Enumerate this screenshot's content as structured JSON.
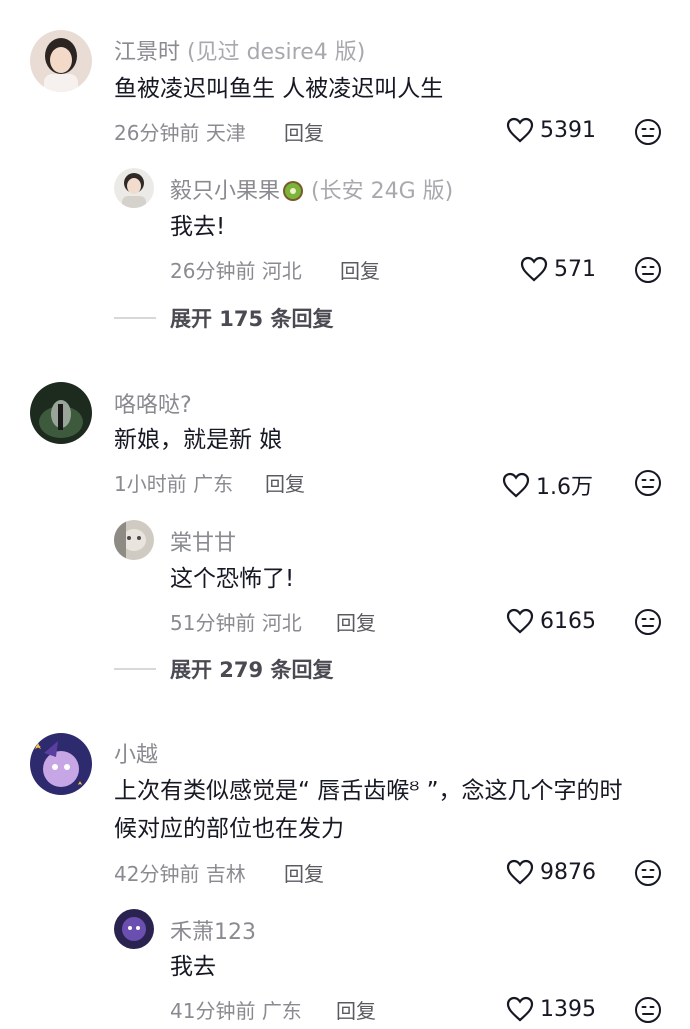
{
  "comments": [
    {
      "name": "江景时",
      "name_suffix": " (见过 desire4 版)",
      "text": "鱼被凌迟叫鱼生 人被凌迟叫人生",
      "time": "26分钟前",
      "location": "天津",
      "reply_label": "回复",
      "likes": "5391",
      "replies": [
        {
          "name": "毅只小果果",
          "name_suffix": " (长安 24G 版)",
          "text": "我去!",
          "time": "26分钟前",
          "location": "河北",
          "reply_label": "回复",
          "likes": "571"
        }
      ],
      "expand_label": "展开 175 条回复"
    },
    {
      "name": "咯咯哒?",
      "text": "新娘，就是新  娘",
      "time": "1小时前",
      "location": "广东",
      "reply_label": "回复",
      "likes": "1.6万",
      "replies": [
        {
          "name": "棠甘甘",
          "text": "这个恐怖了!",
          "time": "51分钟前",
          "location": "河北",
          "reply_label": "回复",
          "likes": "6165"
        }
      ],
      "expand_label": "展开 279 条回复"
    },
    {
      "name": "小越",
      "text_line1": "上次有类似感觉是“ 唇舌齿喉ᴽ ”，念这几个字的时",
      "text_line2": "候对应的部位也在发力",
      "time": "42分钟前",
      "location": "吉林",
      "reply_label": "回复",
      "likes": "9876",
      "replies": [
        {
          "name": "禾萧123",
          "text": "我去",
          "time": "41分钟前",
          "location": "广东",
          "reply_label": "回复",
          "likes": "1395"
        }
      ]
    }
  ],
  "colors": {
    "text": "#161823",
    "meta": "#8a8b91",
    "divider": "#d7d8da"
  },
  "icons": {
    "like": "heart-outline-icon",
    "dislike": "neutral-face-icon",
    "name_badge": "kiwi-icon"
  }
}
